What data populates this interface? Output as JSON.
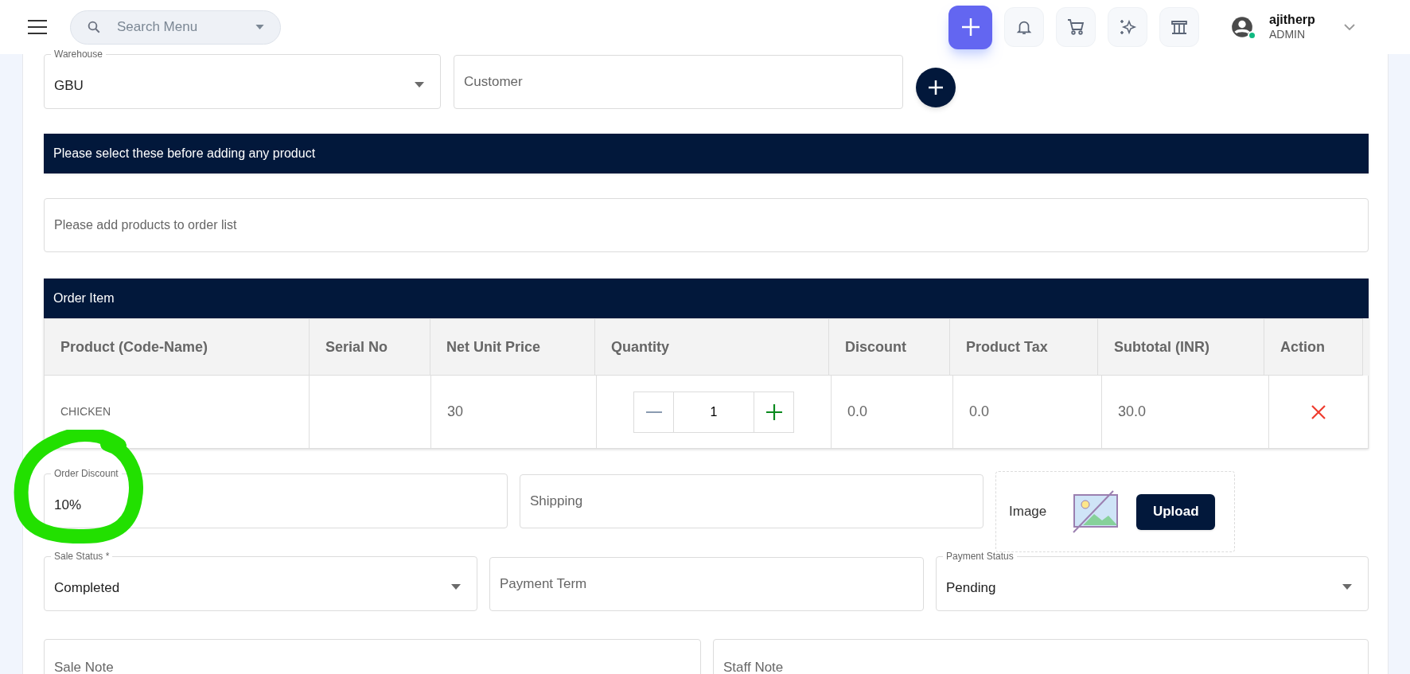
{
  "header": {
    "search": {
      "placeholder": "Search Menu"
    },
    "user": {
      "name": "ajitherp",
      "role": "ADMIN",
      "online": true
    }
  },
  "warehouse": {
    "label": "Warehouse",
    "value": "GBU"
  },
  "customer": {
    "placeholder": "Customer"
  },
  "notice": "Please select these before adding any product",
  "products": {
    "placeholder": "Please add products to order list"
  },
  "order_item": {
    "title": "Order Item",
    "columns": [
      "Product (Code-Name)",
      "Serial No",
      "Net Unit Price",
      "Quantity",
      "Discount",
      "Product Tax",
      "Subtotal (INR)",
      "Action"
    ],
    "rows": [
      {
        "product": "CHICKEN",
        "net_unit_price": "30",
        "quantity": "1",
        "discount": "0.0",
        "product_tax": "0.0",
        "subtotal": "30.0"
      }
    ]
  },
  "order_discount": {
    "label": "Order Discount",
    "value": "10%"
  },
  "shipping": {
    "placeholder": "Shipping"
  },
  "image": {
    "label": "Image",
    "button": "Upload"
  },
  "sale_status": {
    "label": "Sale Status *",
    "value": "Completed"
  },
  "payment_term": {
    "placeholder": "Payment Term"
  },
  "payment_status": {
    "label": "Payment Status",
    "value": "Pending"
  },
  "sale_note": {
    "placeholder": "Sale Note"
  },
  "staff_note": {
    "placeholder": "Staff Note"
  }
}
